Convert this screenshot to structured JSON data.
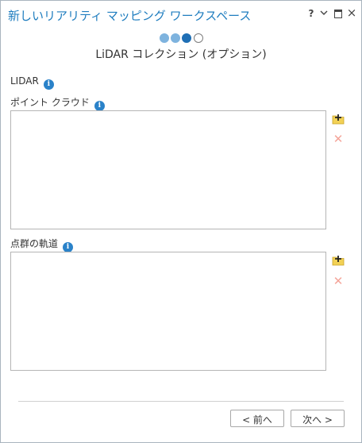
{
  "window": {
    "title": "新しいリアリティ マッピング ワークスペース",
    "help": "?",
    "minimize": "⌄",
    "close": "×"
  },
  "wizard": {
    "steps": [
      "done",
      "done",
      "current",
      "todo"
    ],
    "step_title": "LiDAR コレクション (オプション)"
  },
  "section": {
    "label": "LIDAR"
  },
  "point_cloud": {
    "label": "ポイント クラウド",
    "items": []
  },
  "trajectory": {
    "label": "点群の軌道",
    "items": []
  },
  "icons": {
    "info": "i",
    "remove": "✕",
    "add_folder_color": "#f2d155"
  },
  "footer": {
    "prev_label": "< 前へ",
    "next_label": "次へ >"
  }
}
